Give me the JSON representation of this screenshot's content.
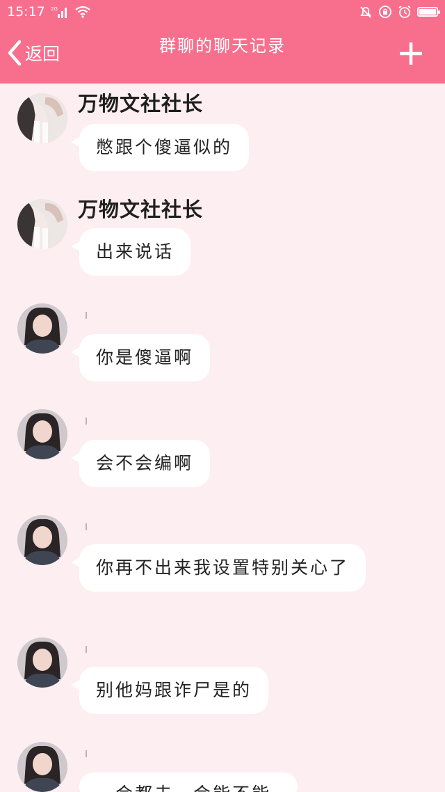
{
  "status_bar": {
    "time": "15:17",
    "network": "2G",
    "icons": [
      "signal-icon",
      "wifi-icon",
      "silent-bell-icon",
      "lock-rotation-icon",
      "alarm-icon",
      "battery-icon"
    ]
  },
  "header": {
    "back_label": "返回",
    "title": "群聊的聊天记录",
    "add_icon": "plus-icon"
  },
  "colors": {
    "header_bg": "#f86f8e",
    "chat_bg": "#fdeef1",
    "bubble_bg": "#ffffff",
    "name_highlight": "#7fdca0"
  },
  "messages": [
    {
      "sender": "万物文社社长",
      "text": "憋跟个傻逼似的",
      "avatar": "girl-photo-avatar"
    },
    {
      "sender": "万物文社社长",
      "text": "出来说话",
      "avatar": "girl-photo-avatar"
    },
    {
      "sender": "",
      "text": "你是傻逼啊",
      "avatar": "girl-portrait-avatar"
    },
    {
      "sender": "",
      "text": "会不会编啊",
      "avatar": "girl-portrait-avatar"
    },
    {
      "sender": "",
      "text": "你再不出来我设置特别关心了",
      "avatar": "girl-portrait-avatar"
    },
    {
      "sender": "",
      "text": "别他妈跟诈尸是的",
      "avatar": "girl-portrait-avatar"
    },
    {
      "sender": "",
      "text": "一会都去一会能不能",
      "avatar": "girl-portrait-avatar"
    }
  ]
}
